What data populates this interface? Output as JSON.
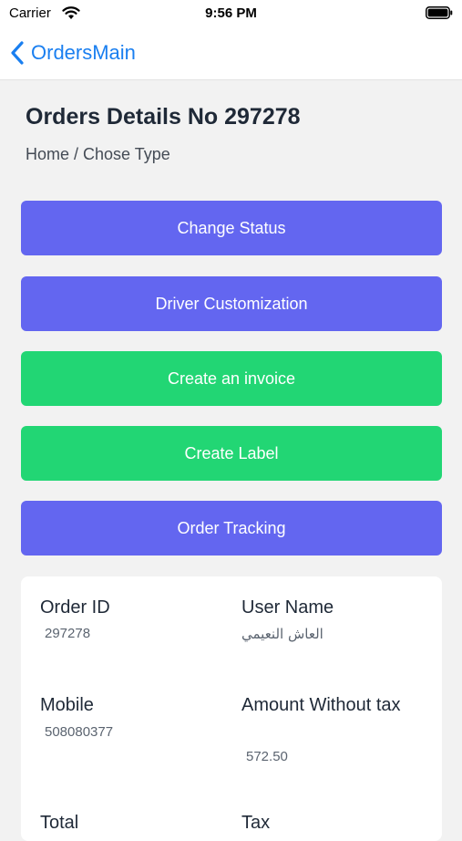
{
  "status_bar": {
    "carrier": "Carrier",
    "time": "9:56 PM"
  },
  "nav": {
    "back_label": "OrdersMain",
    "accent_color": "#1a7ff0"
  },
  "header": {
    "title": "Orders Details No 297278",
    "breadcrumb": "Home / Chose Type"
  },
  "actions": [
    {
      "label": "Change Status",
      "color": "#6366f0"
    },
    {
      "label": "Driver Customization",
      "color": "#6366f0"
    },
    {
      "label": "Create an invoice",
      "color": "#22d674"
    },
    {
      "label": "Create Label",
      "color": "#22d674"
    },
    {
      "label": "Order Tracking",
      "color": "#6366f0"
    }
  ],
  "details": {
    "order_id_label": "Order ID",
    "order_id_value": "297278",
    "user_name_label": "User Name",
    "user_name_value": "العاش النعيمي",
    "mobile_label": "Mobile",
    "mobile_value": "508080377",
    "amount_label": "Amount Without tax",
    "amount_value": "572.50",
    "total_label": "Total",
    "tax_label": "Tax"
  }
}
